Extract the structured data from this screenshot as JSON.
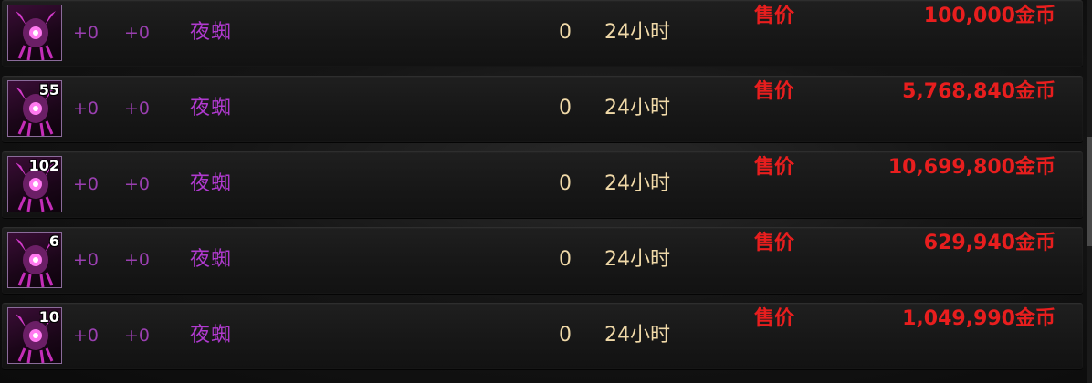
{
  "listings": [
    {
      "stack": "",
      "plus_a": "+0",
      "plus_b": "+0",
      "name": "夜蜘",
      "count": "0",
      "duration": "24小时",
      "price_label": "售价",
      "price": "100,000金币"
    },
    {
      "stack": "55",
      "plus_a": "+0",
      "plus_b": "+0",
      "name": "夜蜘",
      "count": "0",
      "duration": "24小时",
      "price_label": "售价",
      "price": "5,768,840金币"
    },
    {
      "stack": "102",
      "plus_a": "+0",
      "plus_b": "+0",
      "name": "夜蜘",
      "count": "0",
      "duration": "24小时",
      "price_label": "售价",
      "price": "10,699,800金币"
    },
    {
      "stack": "6",
      "plus_a": "+0",
      "plus_b": "+0",
      "name": "夜蜘",
      "count": "0",
      "duration": "24小时",
      "price_label": "售价",
      "price": "629,940金币"
    },
    {
      "stack": "10",
      "plus_a": "+0",
      "plus_b": "+0",
      "name": "夜蜘",
      "count": "0",
      "duration": "24小时",
      "price_label": "售价",
      "price": "1,049,990金币"
    }
  ],
  "colors": {
    "item_name": "#b13ad0",
    "price": "#e81e1e",
    "count": "#f0d9a8",
    "enhance": "#9a3fb0"
  },
  "icons": {
    "item": "spider-mask-icon"
  }
}
